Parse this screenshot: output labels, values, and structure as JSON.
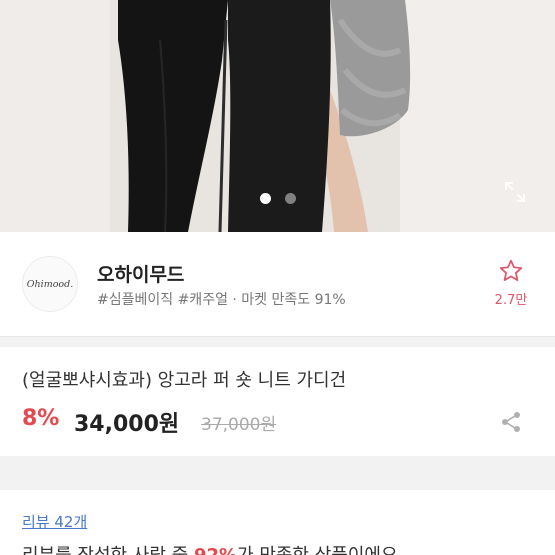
{
  "hero": {
    "image_description": "product photo",
    "carousel": {
      "total": 2,
      "active": 1
    },
    "expand_icon": "expand-icon"
  },
  "seller": {
    "logo_text": "Ohimood.",
    "name": "오하이무드",
    "tags": "#심플베이직 #캐주얼 · 마켓 만족도 91%",
    "like_count": "2.7만",
    "star_icon": "star-outline-icon"
  },
  "product": {
    "title": "(얼굴뽀샤시효과) 앙고라 퍼 숏 니트 가디건",
    "discount": "8%",
    "price": "34,000원",
    "original_price": "37,000원",
    "share_icon": "share-icon"
  },
  "review": {
    "link": "리뷰 42개",
    "summary_prefix": "리뷰를 작성한 사람 중 ",
    "summary_highlight": "92%",
    "summary_suffix": "가 만족한 상품이에요"
  },
  "colors": {
    "accent": "#e5484d",
    "link": "#4a79c9",
    "like": "#e0556a"
  }
}
